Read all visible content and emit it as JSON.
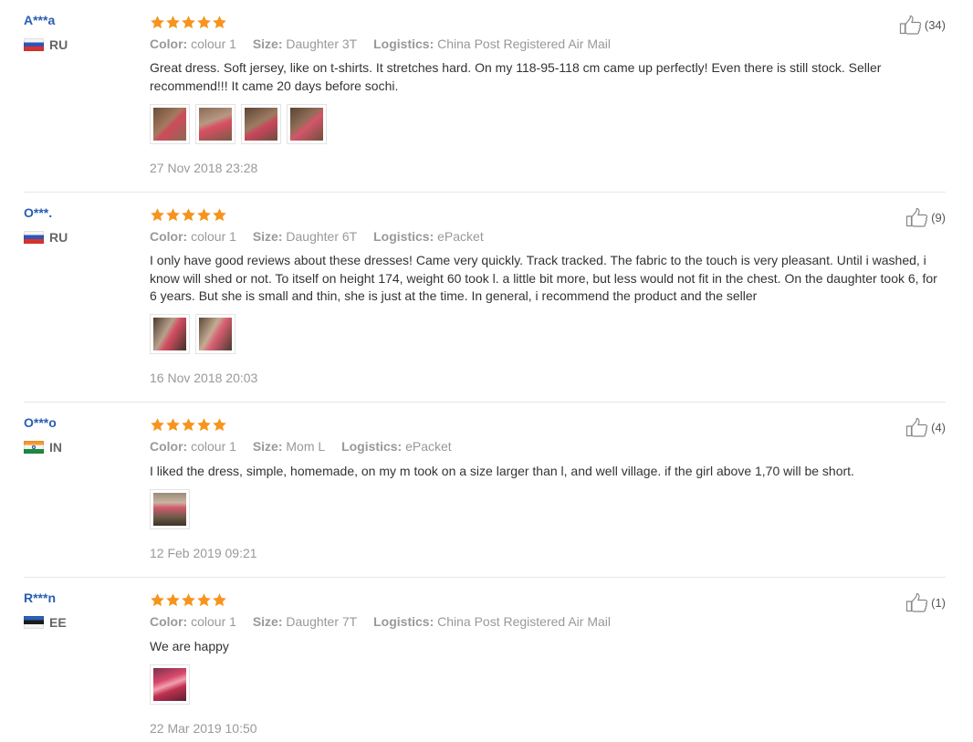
{
  "labels": {
    "color": "Color:",
    "size": "Size:",
    "logistics": "Logistics:"
  },
  "colors": {
    "username": "#2a5db0",
    "star": "#f7941d",
    "muted": "#999999"
  },
  "reviews": [
    {
      "user": "A***a",
      "country": "RU",
      "flag": "russia-flag",
      "rating": 5,
      "color": "colour 1",
      "size": "Daughter 3T",
      "logistics": "China Post Registered Air Mail",
      "text": "Great dress. Soft jersey, like on t-shirts. It stretches hard. On my 118-95-118 cm came up perfectly! Even there is still stock. Seller recommend!!! It came 20 days before sochi.",
      "photos": 4,
      "date": "27 Nov 2018 23:28",
      "helpful": "(34)"
    },
    {
      "user": "O***.",
      "country": "RU",
      "flag": "russia-flag",
      "rating": 5,
      "color": "colour 1",
      "size": "Daughter 6T",
      "logistics": "ePacket",
      "text": "I only have good reviews about these dresses! Came very quickly. Track tracked. The fabric to the touch is very pleasant. Until i washed, i know will shed or not. To itself on height 174, weight 60 took l. a little bit more, but less would not fit in the chest. On the daughter took 6, for 6 years. But she is small and thin, she is just at the time. In general, i recommend the product and the seller",
      "photos": 2,
      "date": "16 Nov 2018 20:03",
      "helpful": "(9)"
    },
    {
      "user": "O***o",
      "country": "IN",
      "flag": "india-flag",
      "rating": 5,
      "color": "colour 1",
      "size": "Mom L",
      "logistics": "ePacket",
      "text": "I liked the dress, simple, homemade, on my m took on a size larger than l, and well village. if the girl above 1,70 will be short.",
      "photos": 1,
      "date": "12 Feb 2019 09:21",
      "helpful": "(4)"
    },
    {
      "user": "R***n",
      "country": "EE",
      "flag": "estonia-flag",
      "rating": 5,
      "color": "colour 1",
      "size": "Daughter 7T",
      "logistics": "China Post Registered Air Mail",
      "text": "We are happy",
      "photos": 1,
      "date": "22 Mar 2019 10:50",
      "helpful": "(1)"
    }
  ]
}
